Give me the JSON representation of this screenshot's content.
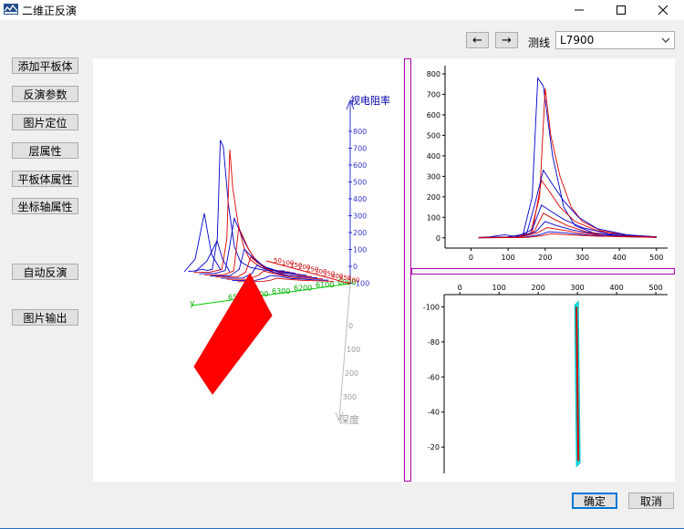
{
  "window": {
    "title": "二维正反演",
    "minimize_icon": "minimize-icon",
    "maximize_icon": "maximize-icon",
    "close_icon": "close-icon"
  },
  "left_buttons": {
    "add_plate": "添加平板体",
    "inversion_params": "反演参数",
    "image_locate": "图片定位",
    "layer_props": "层属性",
    "plate_props": "平板体属性",
    "axis_props": "坐标轴属性",
    "auto_inversion": "自动反演",
    "image_export": "图片输出"
  },
  "nav": {
    "prev_label": "←",
    "next_label": "→",
    "line_label": "测线",
    "line_value": "L7900"
  },
  "view3d": {
    "resistivity_label": "视电阻率",
    "depth_label": "深度",
    "y_axis_label": "y",
    "z_ticks": [
      "800",
      "700",
      "600",
      "500",
      "400",
      "300",
      "200",
      "100",
      "0",
      "-100"
    ],
    "depth_ticks": [
      "0",
      "100",
      "200",
      "300"
    ],
    "green_ticks": [
      "6500",
      "6400",
      "6300",
      "6200",
      "6100",
      "6000"
    ],
    "red_ticks": [
      "50",
      "100",
      "150",
      "200",
      "250",
      "300",
      "350",
      "400",
      "450",
      "500"
    ]
  },
  "chart_data": [
    {
      "type": "line",
      "x_ticks": [
        "0",
        "100",
        "200",
        "300",
        "400",
        "500"
      ],
      "y_ticks": [
        "800",
        "700",
        "600",
        "500",
        "400",
        "300",
        "200",
        "100",
        "0"
      ],
      "xlim": [
        -70,
        530
      ],
      "ylim": [
        -50,
        840
      ],
      "colors": [
        "#0000cc",
        "#dd0000"
      ],
      "series": [
        {
          "color": "#0000cc",
          "points": [
            [
              20,
              2
            ],
            [
              50,
              5
            ],
            [
              90,
              15
            ],
            [
              115,
              8
            ],
            [
              140,
              15
            ],
            [
              165,
              200
            ],
            [
              180,
              780
            ],
            [
              195,
              740
            ],
            [
              220,
              400
            ],
            [
              250,
              150
            ],
            [
              280,
              60
            ],
            [
              330,
              25
            ],
            [
              400,
              10
            ],
            [
              500,
              5
            ]
          ]
        },
        {
          "color": "#dd0000",
          "points": [
            [
              20,
              2
            ],
            [
              100,
              5
            ],
            [
              160,
              20
            ],
            [
              185,
              200
            ],
            [
              200,
              730
            ],
            [
              215,
              500
            ],
            [
              240,
              300
            ],
            [
              270,
              150
            ],
            [
              300,
              80
            ],
            [
              350,
              35
            ],
            [
              420,
              12
            ],
            [
              500,
              5
            ]
          ]
        },
        {
          "color": "#0000cc",
          "points": [
            [
              20,
              1
            ],
            [
              100,
              4
            ],
            [
              150,
              20
            ],
            [
              170,
              150
            ],
            [
              195,
              330
            ],
            [
              220,
              260
            ],
            [
              250,
              180
            ],
            [
              290,
              100
            ],
            [
              340,
              45
            ],
            [
              420,
              15
            ],
            [
              500,
              5
            ]
          ]
        },
        {
          "color": "#dd0000",
          "points": [
            [
              20,
              1
            ],
            [
              120,
              3
            ],
            [
              165,
              25
            ],
            [
              190,
              280
            ],
            [
              210,
              230
            ],
            [
              240,
              150
            ],
            [
              280,
              80
            ],
            [
              340,
              35
            ],
            [
              420,
              12
            ],
            [
              500,
              4
            ]
          ]
        },
        {
          "color": "#0000cc",
          "points": [
            [
              20,
              1
            ],
            [
              120,
              3
            ],
            [
              165,
              40
            ],
            [
              190,
              160
            ],
            [
              215,
              130
            ],
            [
              250,
              90
            ],
            [
              300,
              50
            ],
            [
              370,
              20
            ],
            [
              500,
              5
            ]
          ]
        },
        {
          "color": "#dd0000",
          "points": [
            [
              20,
              1
            ],
            [
              130,
              3
            ],
            [
              170,
              30
            ],
            [
              195,
              120
            ],
            [
              225,
              90
            ],
            [
              260,
              60
            ],
            [
              310,
              30
            ],
            [
              380,
              12
            ],
            [
              500,
              4
            ]
          ]
        },
        {
          "color": "#0000cc",
          "points": [
            [
              20,
              1
            ],
            [
              130,
              2
            ],
            [
              175,
              30
            ],
            [
              200,
              80
            ],
            [
              230,
              60
            ],
            [
              270,
              40
            ],
            [
              330,
              20
            ],
            [
              420,
              8
            ],
            [
              500,
              3
            ]
          ]
        },
        {
          "color": "#dd0000",
          "points": [
            [
              20,
              1
            ],
            [
              130,
              2
            ],
            [
              180,
              25
            ],
            [
              205,
              50
            ],
            [
              240,
              40
            ],
            [
              290,
              25
            ],
            [
              360,
              10
            ],
            [
              500,
              3
            ]
          ]
        },
        {
          "color": "#0000cc",
          "points": [
            [
              20,
              0
            ],
            [
              140,
              2
            ],
            [
              185,
              15
            ],
            [
              210,
              30
            ],
            [
              250,
              25
            ],
            [
              320,
              12
            ],
            [
              420,
              5
            ],
            [
              500,
              2
            ]
          ]
        },
        {
          "color": "#dd0000",
          "points": [
            [
              20,
              0
            ],
            [
              150,
              2
            ],
            [
              190,
              10
            ],
            [
              215,
              20
            ],
            [
              260,
              15
            ],
            [
              340,
              8
            ],
            [
              500,
              2
            ]
          ]
        }
      ]
    },
    {
      "type": "scatter",
      "x_ticks": [
        "0",
        "100",
        "200",
        "300",
        "400",
        "500"
      ],
      "y_ticks": [
        "-100",
        "-80",
        "-60",
        "-40",
        "-20"
      ],
      "xlim": [
        -40,
        530
      ],
      "ylim": [
        -107,
        -5
      ],
      "colors": [
        "#00e0e0",
        "#dd0000"
      ],
      "plate": {
        "x_top": 300,
        "y_top": -102,
        "x_bottom": 300,
        "y_bottom": -10
      }
    }
  ]
}
